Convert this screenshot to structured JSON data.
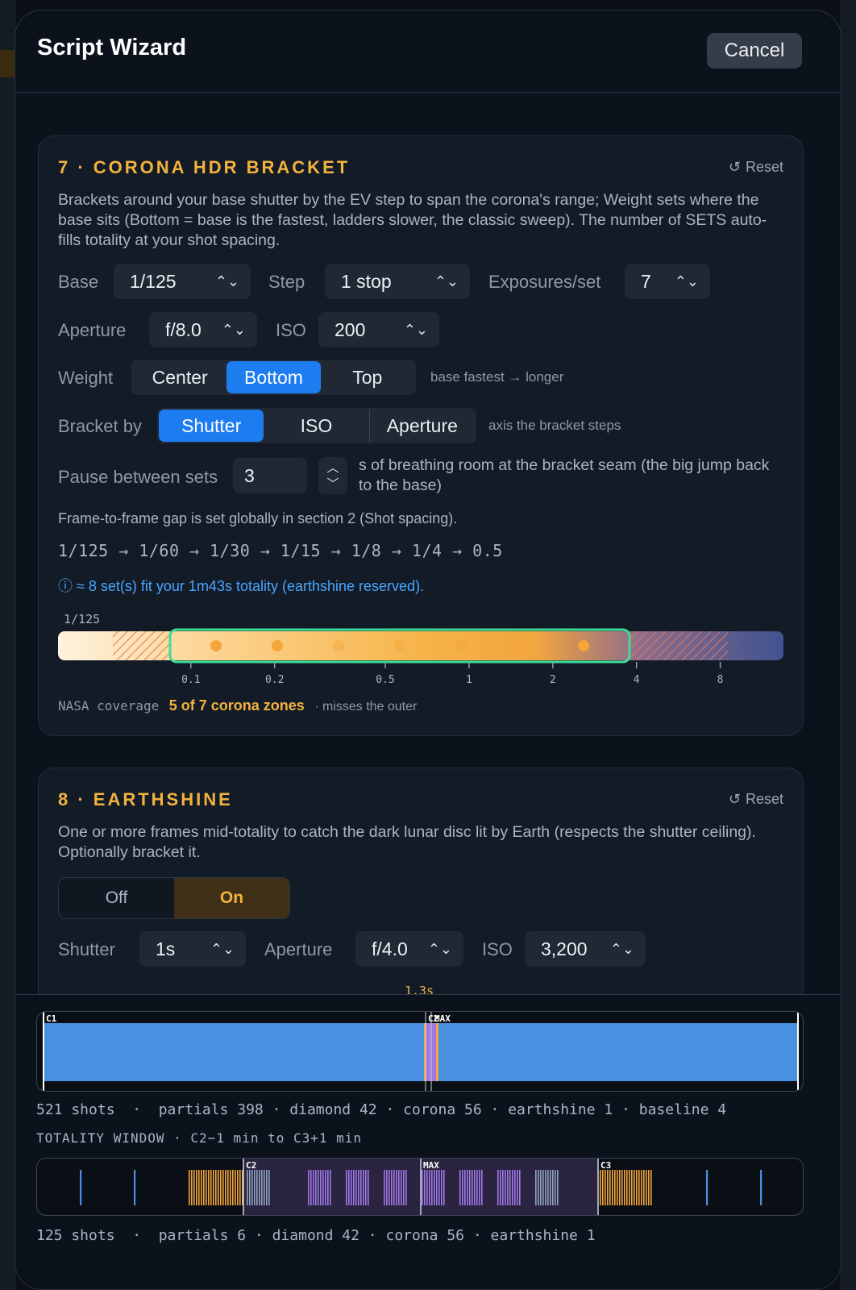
{
  "window": {
    "title": "Script Wizard",
    "cancel_label": "Cancel"
  },
  "section7": {
    "title": "7 · CORONA HDR BRACKET",
    "reset_label": "Reset",
    "description": "Brackets around your base shutter by the EV step to span the corona's range; Weight sets where the base sits (Bottom = base is the fastest, ladders slower, the classic sweep). The number of SETS auto-fills totality at your shot spacing.",
    "base_label": "Base",
    "base_value": "1/125",
    "step_label": "Step",
    "step_value": "1 stop",
    "exposures_label": "Exposures/set",
    "exposures_value": "7",
    "aperture_label": "Aperture",
    "aperture_value": "f/8.0",
    "iso_label": "ISO",
    "iso_value": "200",
    "weight_label": "Weight",
    "weight_options": [
      "Center",
      "Bottom",
      "Top"
    ],
    "weight_selected": "Bottom",
    "weight_note": "base fastest → longer",
    "bracket_label": "Bracket by",
    "bracket_options": [
      "Shutter",
      "ISO",
      "Aperture"
    ],
    "bracket_selected": "Shutter",
    "bracket_note": "axis the bracket steps",
    "pause_label": "Pause between sets",
    "pause_value": "3",
    "pause_note": "s of breathing room at the bracket seam (the big jump back to the base)",
    "gap_note": "Frame-to-frame gap is set globally in section 2 (Shot spacing).",
    "chain": "1/125 → 1/60 → 1/30 → 1/15 → 1/8 → 1/4 → 0.5",
    "info": "≈ 8 set(s) fit your 1m43s totality (earthshine reserved).",
    "scale_top_label": "1/125",
    "scale_ticks": [
      "0.1",
      "0.2",
      "0.5",
      "1",
      "2",
      "4",
      "8"
    ],
    "coverage_prefix": "NASA coverage",
    "coverage_value": "5 of 7 corona zones",
    "coverage_suffix": "· misses the outer"
  },
  "section8": {
    "title": "8 · EARTHSHINE",
    "reset_label": "Reset",
    "description": "One or more frames mid-totality to catch the dark lunar disc lit by Earth (respects the shutter ceiling). Optionally bracket it.",
    "toggle_options": [
      "Off",
      "On"
    ],
    "toggle_selected": "On",
    "shutter_label": "Shutter",
    "shutter_value": "1s",
    "aperture_label": "Aperture",
    "aperture_value": "f/4.0",
    "iso_label": "ISO",
    "iso_value": "3,200",
    "marker": "1.3s"
  },
  "timeline": {
    "full": {
      "contact_labels": [
        "C1",
        "C2",
        "MAX"
      ],
      "summary": "521 shots  ·  partials 398 · diamond 42 · corona 56 · earthshine 1 · baseline 4"
    },
    "window_title": "TOTALITY WINDOW · C2−1 min to C3+1 min",
    "zoom": {
      "contact_labels": [
        "C2",
        "MAX",
        "C3"
      ],
      "summary": "125 shots  ·  partials 6 · diamond 42 · corona 56 · earthshine 1"
    }
  },
  "colors": {
    "accent": "#f4b23c",
    "selected": "#1d7cf0",
    "info": "#4aa6ff",
    "partials": "#4a90e2",
    "diamond": "#f5a53a",
    "corona": "#a078e8",
    "earthshine": "#8fa3bf"
  }
}
